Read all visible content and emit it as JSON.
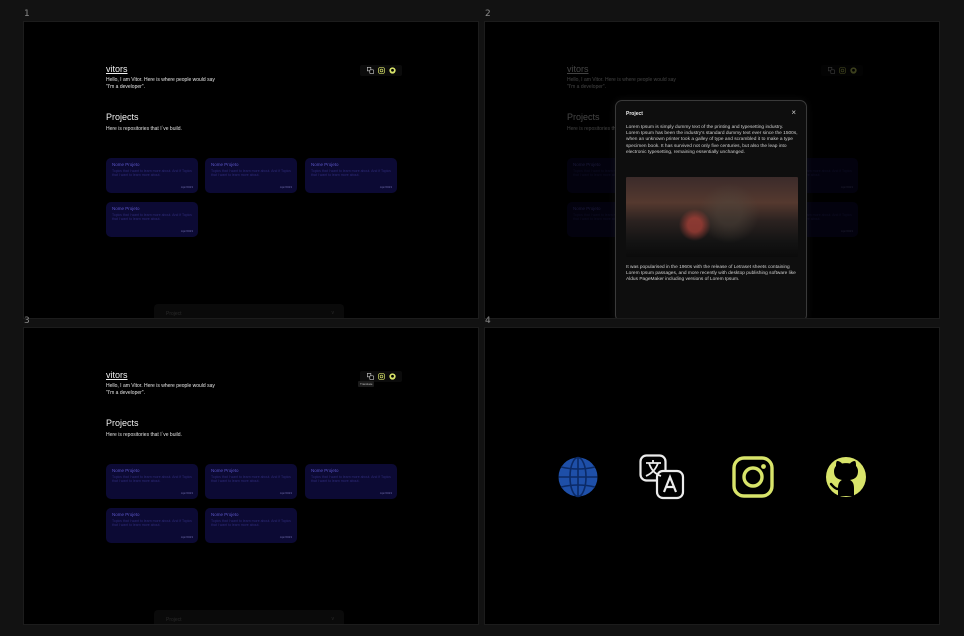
{
  "labels": {
    "p1": "1",
    "p2": "2",
    "p3": "3",
    "p4": "4"
  },
  "app": {
    "brand": "vitors",
    "intro": "Hello, I am Vitor.   Here is where people would say \"I'm a developer\".",
    "projects_title": "Projects",
    "projects_sub": "Here is repositories that I`ve build.",
    "footer": {
      "label": "Project",
      "chevron": "v"
    },
    "icons": [
      "translate-icon",
      "instagram-icon",
      "github-icon"
    ],
    "tooltip": "Translate"
  },
  "cards": [
    {
      "title": "Nome Projeto",
      "desc": "Topics that I want to learn more about. And if Topics that I want to learn more about.",
      "date": "Apr/2023"
    },
    {
      "title": "Nome Projeto",
      "desc": "Topics that I want to learn more about. And if Topics that I want to learn more about.",
      "date": "Apr/2023"
    },
    {
      "title": "Nome Projeto",
      "desc": "Topics that I want to learn more about. And if Topics that I want to learn more about.",
      "date": "Apr/2023"
    },
    {
      "title": "Nome Projeto",
      "desc": "Topics that I want to learn more about. And if Topics that I want to learn more about.",
      "date": "Apr/2023"
    },
    {
      "title": "Nome Projeto",
      "desc": "Topics that I want to learn more about. And if Topics that I want to learn more about.",
      "date": "Apr/2023"
    }
  ],
  "modal": {
    "title": "Project",
    "close": "×",
    "p1": "Lorem Ipsum is simply dummy text of the printing and typesetting industry. Lorem Ipsum has been the industry's standard dummy text ever since the 1500s, when an unknown printer took a galley of type and scrambled it to make a type specimen book. It has survived not only five centuries, but also the leap into electronic typesetting, remaining essentially unchanged.",
    "p2": "It was popularised in the 1960s with the release of Letraset sheets containing Lorem Ipsum passages, and more recently with desktop publishing software like Aldus PageMaker including versions of Lorem Ipsum."
  },
  "big_icons": [
    "globe-icon",
    "translate-icon",
    "instagram-icon",
    "github-icon"
  ],
  "colors": {
    "bg": "#000000",
    "card": "#0c0a34",
    "card_title": "#5b55c8",
    "accent_green": "#d8e46a",
    "globe_blue": "#1e4fa8"
  }
}
